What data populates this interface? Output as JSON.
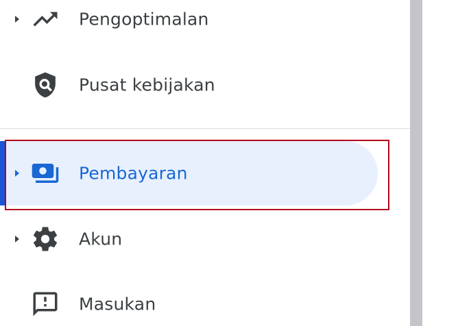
{
  "sidebar": {
    "items": [
      {
        "label": "Pengoptimalan",
        "icon": "trending-up-icon",
        "expandable": true
      },
      {
        "label": "Pusat kebijakan",
        "icon": "policy-shield-icon",
        "expandable": false
      },
      {
        "label": "Pembayaran",
        "icon": "payments-icon",
        "expandable": true,
        "selected": true
      },
      {
        "label": "Akun",
        "icon": "gear-icon",
        "expandable": true
      },
      {
        "label": "Masukan",
        "icon": "feedback-icon",
        "expandable": false
      }
    ]
  },
  "colors": {
    "text": "#3c4043",
    "selected_text": "#1967d2",
    "selected_background": "#e8f0fe",
    "selected_indicator": "#1a56d6",
    "highlight_outline": "#b3001b",
    "divider": "#dadce0",
    "scrollbar": "#c4c5c8"
  }
}
